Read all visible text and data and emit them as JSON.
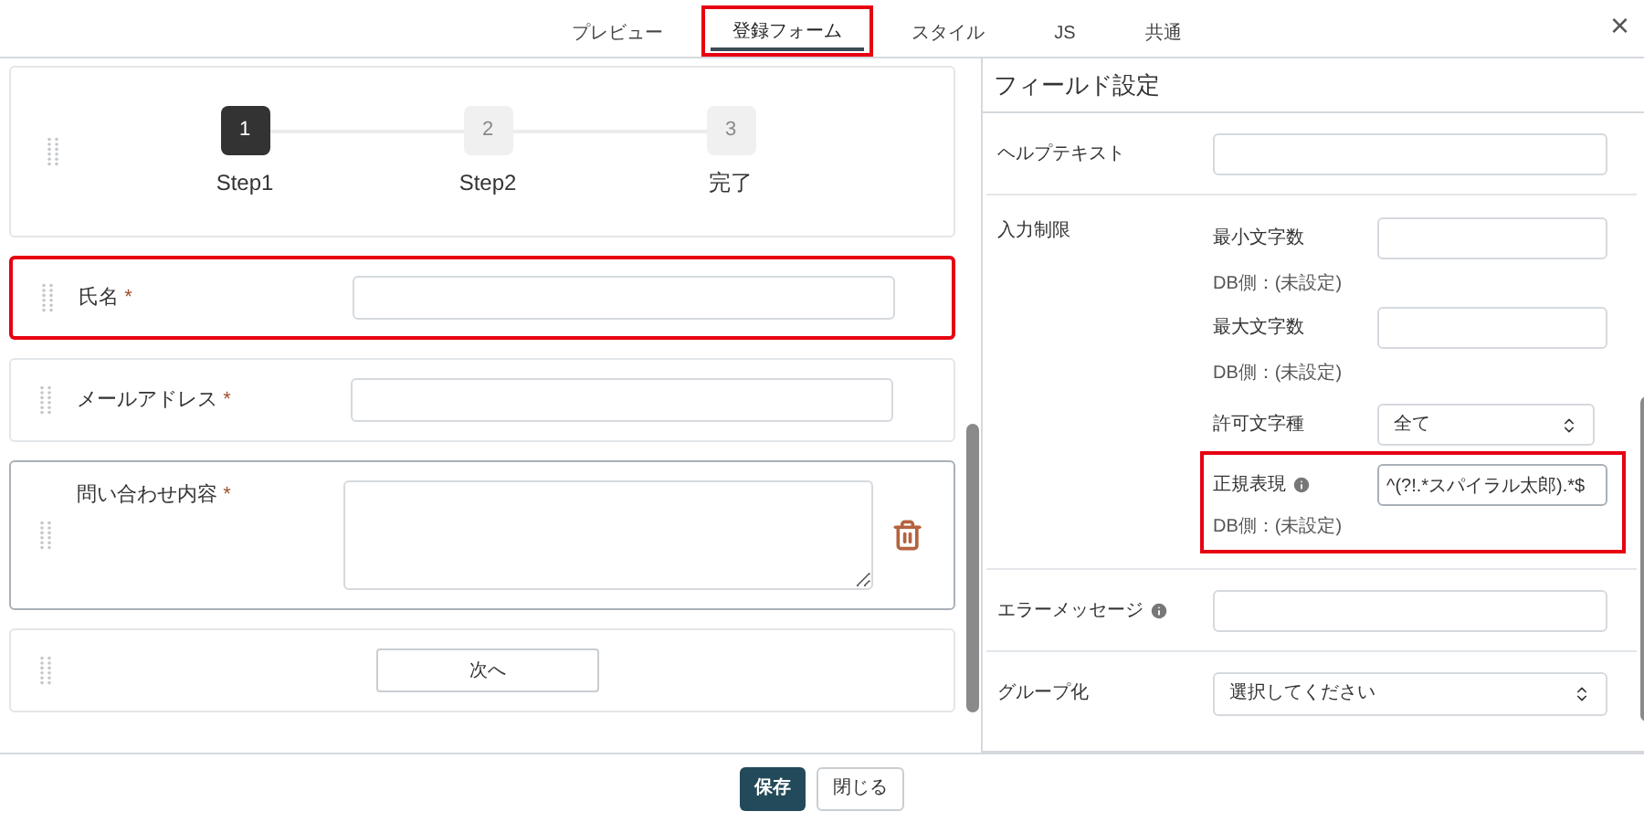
{
  "tabs": [
    {
      "label": "プレビュー",
      "selected": false,
      "highlighted": false
    },
    {
      "label": "登録フォーム",
      "selected": true,
      "highlighted": true
    },
    {
      "label": "スタイル",
      "selected": false,
      "highlighted": false
    },
    {
      "label": "JS",
      "selected": false,
      "highlighted": false
    },
    {
      "label": "共通",
      "selected": false,
      "highlighted": false
    }
  ],
  "close": "×",
  "steps": [
    {
      "number": "1",
      "label": "Step1",
      "selected": true
    },
    {
      "number": "2",
      "label": "Step2",
      "selected": false
    },
    {
      "number": "3",
      "label": "完了",
      "selected": false
    }
  ],
  "fields": [
    {
      "kind": "input",
      "label": "氏名",
      "required": "*",
      "highlighted": true,
      "selected": false
    },
    {
      "kind": "input",
      "label": "メールアドレス",
      "required": "*",
      "highlighted": false,
      "selected": false
    },
    {
      "kind": "textarea",
      "label": "問い合わせ内容",
      "required": "*",
      "highlighted": false,
      "selected": true
    }
  ],
  "next_button": "次へ",
  "settings": {
    "title": "フィールド設定",
    "help_text": {
      "label": "ヘルプテキスト"
    },
    "input_limit": {
      "label": "入力制限",
      "min": {
        "label": "最小文字数",
        "db": "DB側：(未設定)"
      },
      "max": {
        "label": "最大文字数",
        "db": "DB側：(未設定)"
      },
      "allowed": {
        "label": "許可文字種",
        "value": "全て"
      },
      "regex": {
        "label": "正規表現",
        "value": "^(?!.*スパイラル太郎).*$",
        "db": "DB側：(未設定)",
        "highlighted": true
      }
    },
    "error_message": {
      "label": "エラーメッセージ"
    },
    "grouping": {
      "label": "グループ化",
      "value": "選択してください"
    }
  },
  "footer": {
    "save": "保存",
    "close": "閉じる"
  }
}
